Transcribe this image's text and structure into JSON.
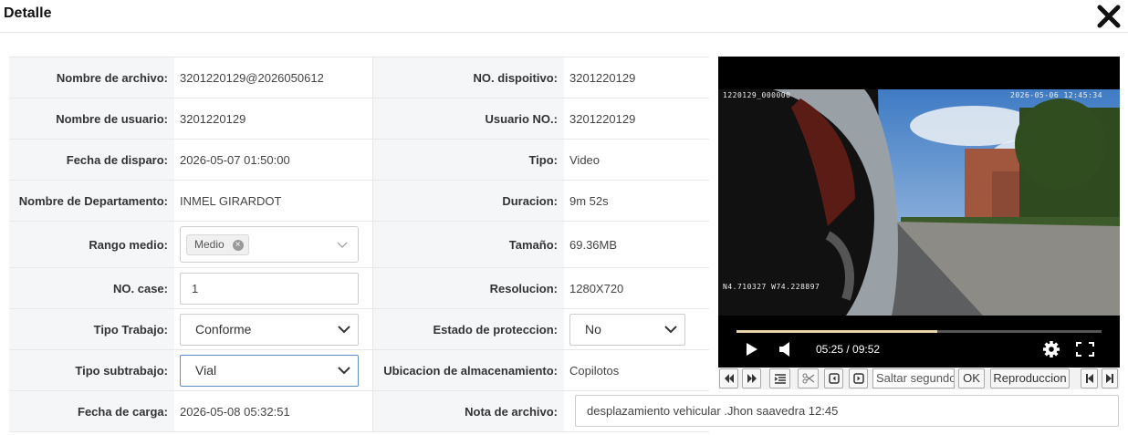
{
  "header": {
    "title": "Detalle",
    "close_icon": "close-icon"
  },
  "fields": {
    "nombre_archivo": {
      "label": "Nombre de archivo:",
      "value": "3201220129@2026050612"
    },
    "dispositivo": {
      "label": "NO. dispoitivo:",
      "value": "3201220129"
    },
    "nombre_usuario": {
      "label": "Nombre de usuario:",
      "value": "3201220129"
    },
    "usuario_no": {
      "label": "Usuario NO.:",
      "value": "3201220129"
    },
    "fecha_disparo": {
      "label": "Fecha de disparo:",
      "value": "2026-05-07 01:50:00"
    },
    "tipo": {
      "label": "Tipo:",
      "value": "Video"
    },
    "departamento": {
      "label": "Nombre de Departamento:",
      "value": "INMEL GIRARDOT"
    },
    "duracion": {
      "label": "Duracion:",
      "value": "9m 52s"
    },
    "rango_medio": {
      "label": "Rango medio:",
      "tag": "Medio"
    },
    "tamano": {
      "label": "Tamaño:",
      "value": "69.36MB"
    },
    "no_case": {
      "label": "NO. case:",
      "value": "1"
    },
    "resolucion": {
      "label": "Resolucion:",
      "value": "1280X720"
    },
    "tipo_trabajo": {
      "label": "Tipo Trabajo:",
      "value": "Conforme"
    },
    "estado_proteccion": {
      "label": "Estado de proteccion:",
      "value": "No"
    },
    "tipo_subtrabajo": {
      "label": "Tipo subtrabajo:",
      "value": "Vial"
    },
    "ubicacion": {
      "label": "Ubicacion de almacenamiento:",
      "value": "Copilotos"
    },
    "fecha_carga": {
      "label": "Fecha de carga:",
      "value": "2026-05-08 05:32:51"
    },
    "nota_archivo": {
      "label": "Nota de archivo:",
      "value": "desplazamiento vehicular .Jhon saavedra 12:45"
    }
  },
  "player": {
    "overlay_id": "1220129_000000",
    "overlay_datetime": "2026-05-06 12:45:34",
    "overlay_coords": "N4.710327 W74.228897",
    "time_display": "05:25 / 09:52",
    "progress_fraction": 0.55,
    "toolbar": {
      "seek_placeholder": "Saltar segundos",
      "ok_label": "OK",
      "playback_label": "Reproduccion"
    }
  },
  "colors": {
    "accent_focus": "#5b8fc9",
    "progress": "#e8d3a6"
  }
}
